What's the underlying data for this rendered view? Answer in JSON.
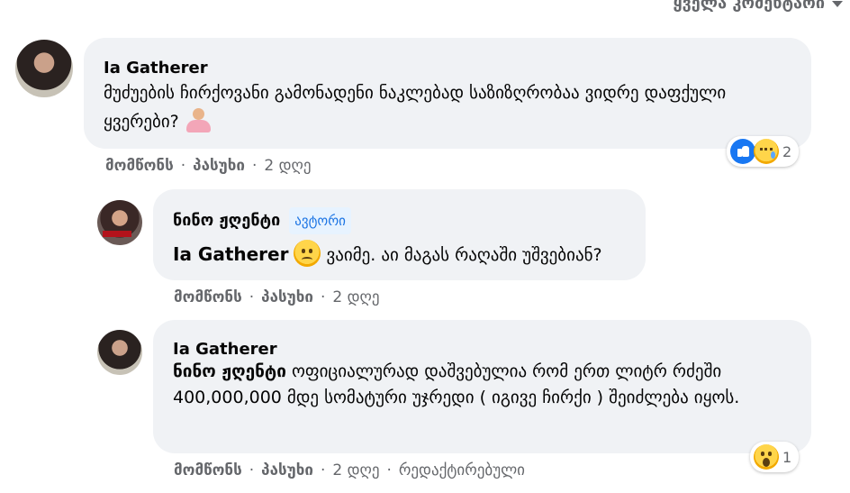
{
  "filter": {
    "label": "ყველა კომენტარი"
  },
  "comments": [
    {
      "author": "Ia Gatherer",
      "text": "მუძუების ჩირქოვანი გამონადენი ნაკლებად საზიზღრობაა ვიდრე დაფქული ყვერები?",
      "emoji": "person-shrugging-icon",
      "actions": {
        "like": "მომწონს",
        "reply": "პასუხი",
        "time": "2 დღე"
      },
      "reactions": {
        "icons": [
          "like-icon",
          "sad-icon"
        ],
        "count": "2"
      }
    },
    {
      "author": "ნინო ჟღენტი",
      "badge": "ავტორი",
      "mention": "Ia Gatherer",
      "text": "ვაიმე. აი მაგას რაღაში უშვებიან?",
      "emoji": "frowning-face-icon",
      "actions": {
        "like": "მომწონს",
        "reply": "პასუხი",
        "time": "2 დღე"
      }
    },
    {
      "author": "Ia Gatherer",
      "mention": "ნინო ჟღენტი",
      "text": "ოფიციალურად დაშვებულია რომ ერთ ლიტრ რძეში 400,000,000 მდე სომატური უჯრედი ( იგივე ჩირქი ) შეიძლება იყოს.",
      "actions": {
        "like": "მომწონს",
        "reply": "პასუხი",
        "time": "2 დღე",
        "edited": "რედაქტირებული"
      },
      "reactions": {
        "icons": [
          "wow-icon"
        ],
        "count": "1"
      }
    }
  ]
}
